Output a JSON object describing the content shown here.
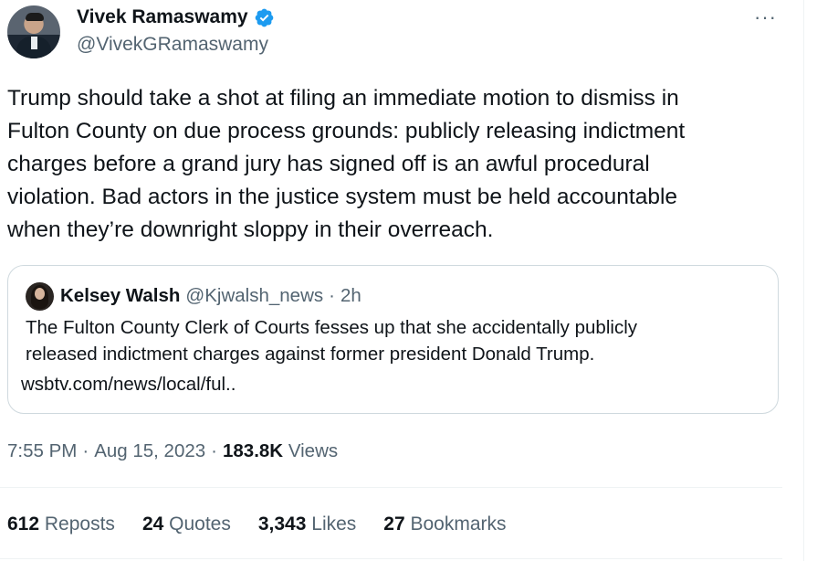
{
  "author": {
    "display_name": "Vivek Ramaswamy",
    "handle": "@VivekGRamaswamy",
    "verified": true
  },
  "icons": {
    "verified": "verified-badge-icon",
    "more": "more-options-icon"
  },
  "more_glyph": "···",
  "tweet": {
    "lines": [
      "Trump should take a shot at filing an immediate motion to dismiss in",
      "Fulton County on due process grounds: publicly releasing indictment",
      "charges before a grand jury has signed off is an awful procedural",
      "violation. Bad actors in the justice system must be held accountable",
      "when they’re downright sloppy in their overreach."
    ]
  },
  "quote": {
    "name": "Kelsey Walsh",
    "handle": "@Kjwalsh_news",
    "separator": "·",
    "time": "2h",
    "lines": [
      "The Fulton County Clerk of Courts fesses up that she accidentally publicly",
      "released indictment charges against former president Donald Trump."
    ],
    "link": "wsbtv.com/news/local/ful.."
  },
  "meta": {
    "time": "7:55 PM",
    "sep1": "·",
    "date": "Aug 15, 2023",
    "sep2": "·",
    "views_count": "183.8K",
    "views_label": "Views"
  },
  "stats": [
    {
      "count": "612",
      "label": "Reposts"
    },
    {
      "count": "24",
      "label": "Quotes"
    },
    {
      "count": "3,343",
      "label": "Likes"
    },
    {
      "count": "27",
      "label": "Bookmarks"
    }
  ],
  "colors": {
    "primary_text": "#0f1419",
    "secondary_text": "#536471",
    "verified_blue": "#1d9bf0",
    "border": "#cfd9de"
  }
}
